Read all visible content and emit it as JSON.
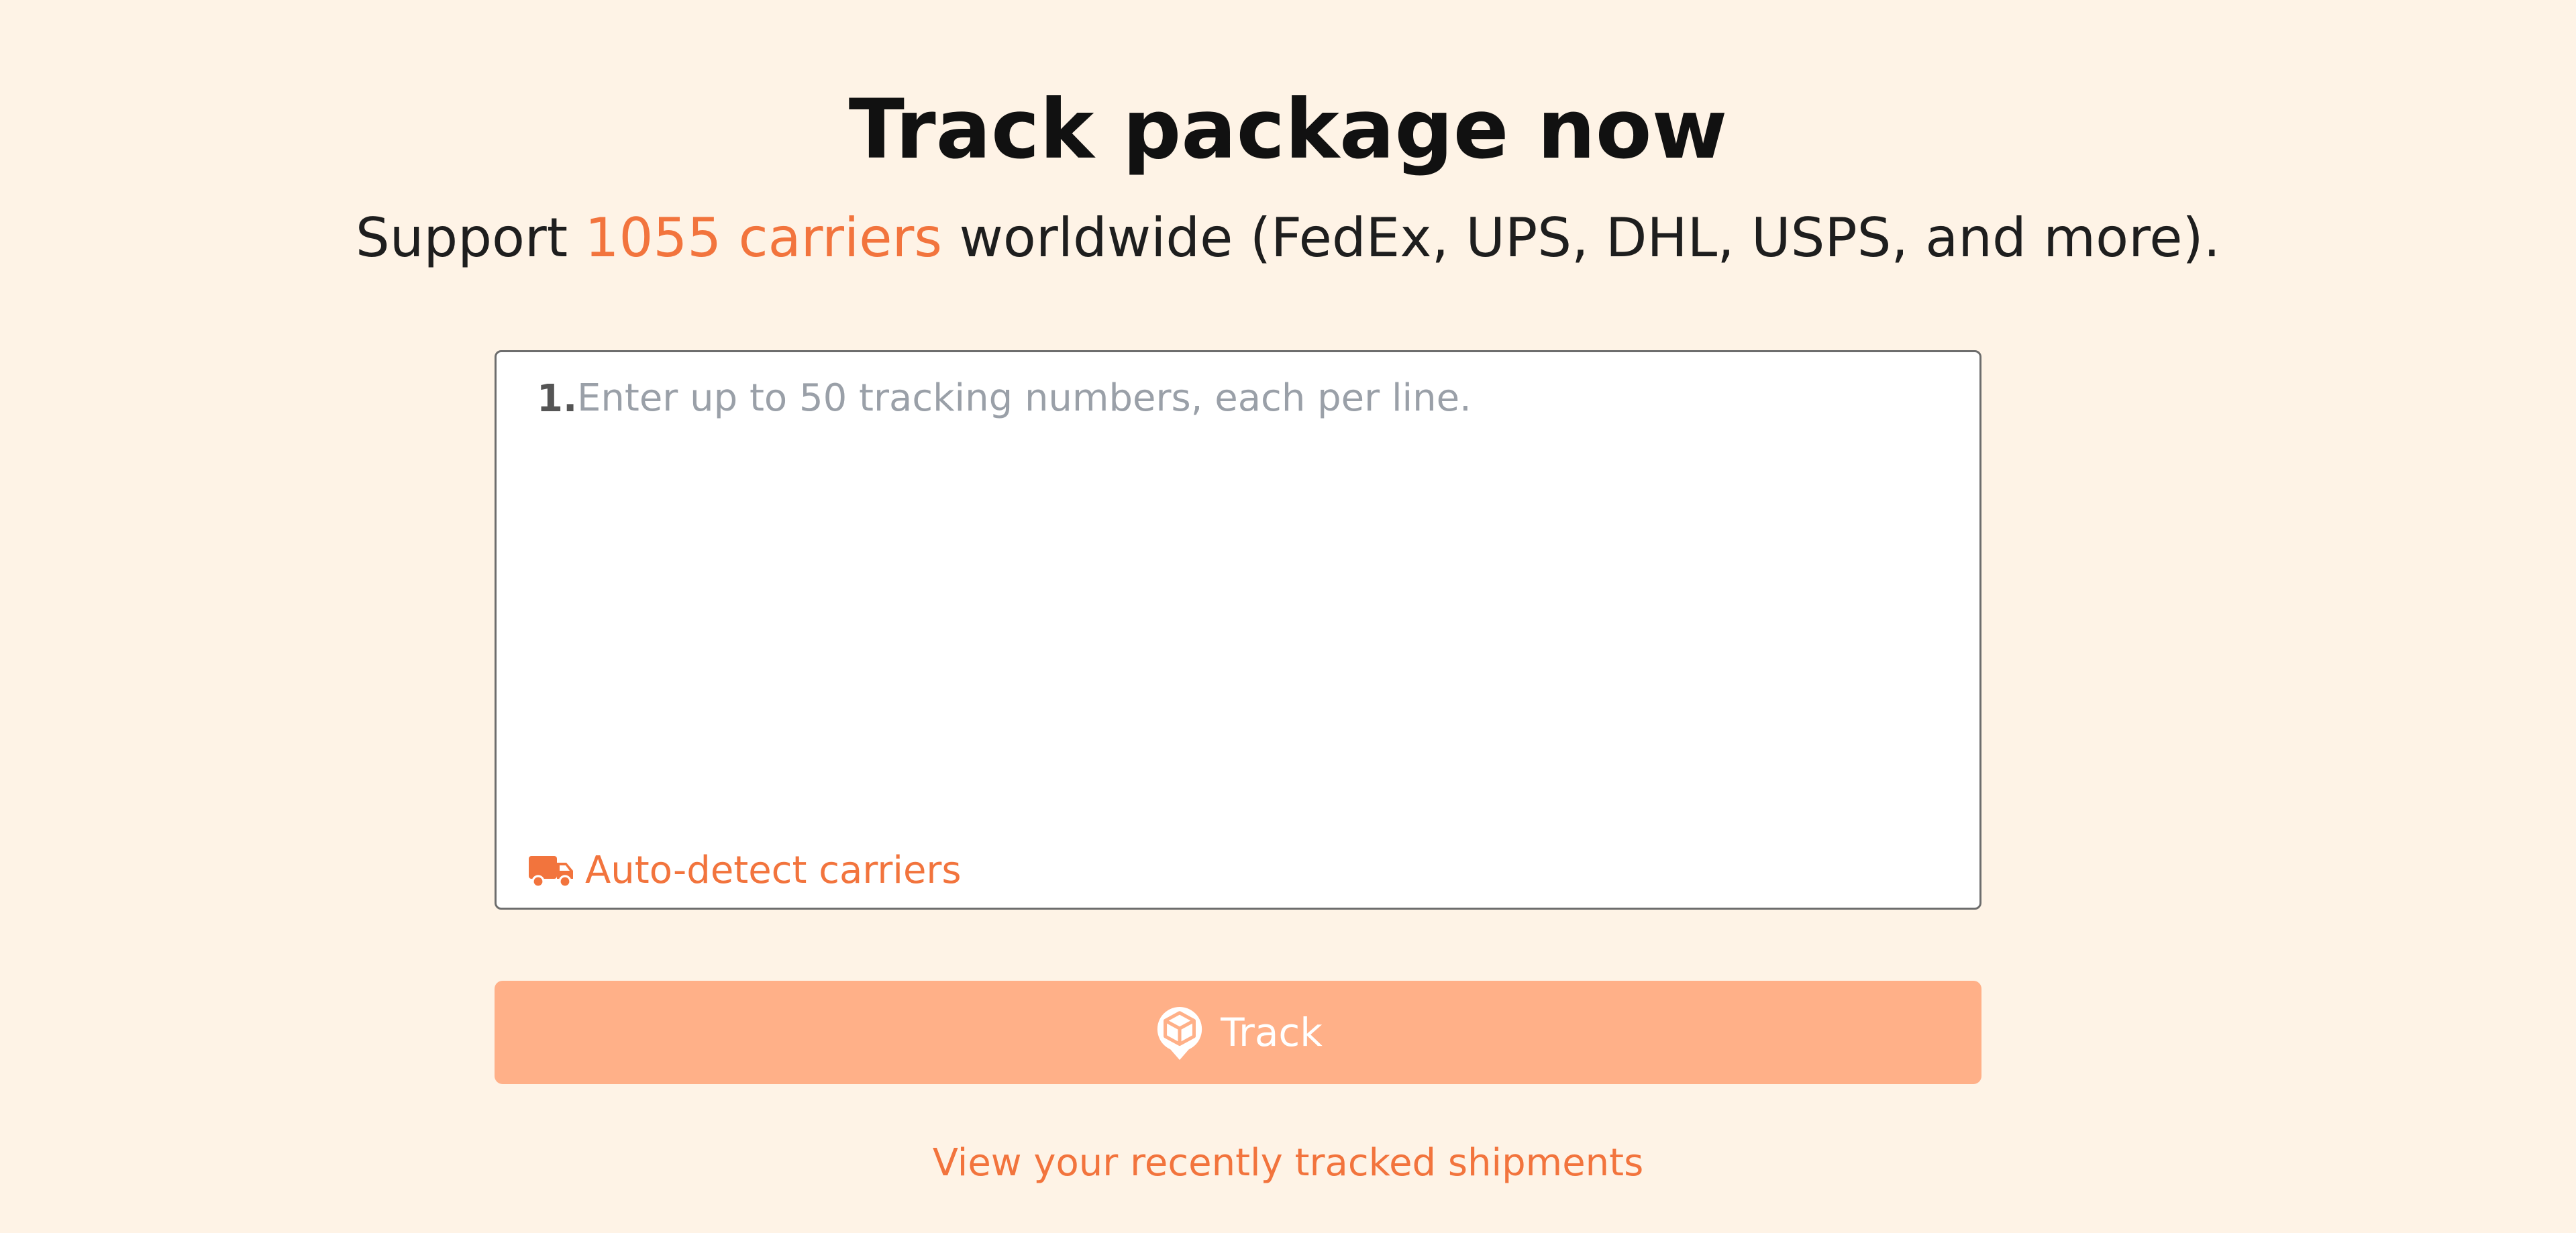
{
  "header": {
    "title": "Track package now",
    "subtitle_prefix": "Support ",
    "subtitle_highlight": "1055 carriers",
    "subtitle_suffix": " worldwide (FedEx, UPS, DHL, USPS, and more)."
  },
  "tracking_form": {
    "line_number": "1.",
    "placeholder": "Enter up to 50 tracking numbers, each per line.",
    "value": "",
    "auto_detect_label": "Auto-detect carriers",
    "auto_detect_icon": "truck-icon"
  },
  "track_button": {
    "label": "Track",
    "icon": "package-icon"
  },
  "footer": {
    "recent_link_label": "View your recently tracked shipments"
  },
  "colors": {
    "background": "#fef3e6",
    "accent": "#f2743d",
    "button_background": "#ffb088",
    "text_primary": "#111111",
    "placeholder": "#9aa0a8"
  }
}
